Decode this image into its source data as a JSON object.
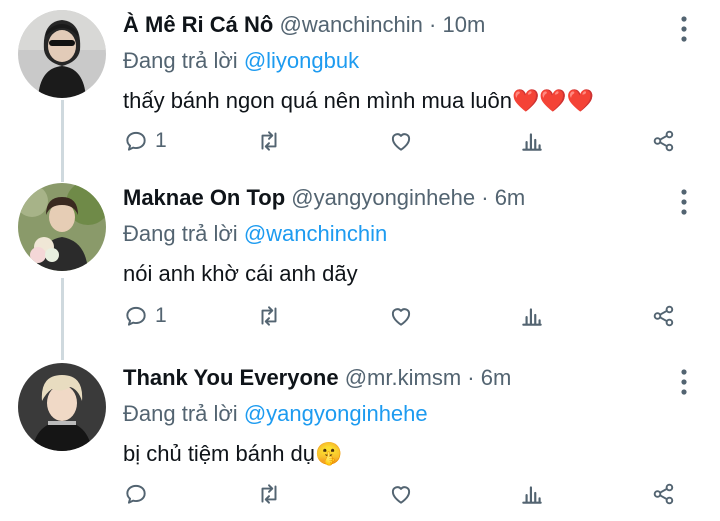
{
  "tweets": [
    {
      "name": "À Mê Ri Cá Nô",
      "handle": "@wanchinchin",
      "separator": "·",
      "time": "10m",
      "replying_prefix": "Đang trả lời",
      "replying_to": "@liyongbuk",
      "text": "thấy bánh ngon quá nên mình mua luôn",
      "emoji": "❤️❤️❤️",
      "reply_count": "1"
    },
    {
      "name": "Maknae On Top",
      "handle": "@yangyonginhehe",
      "separator": "·",
      "time": "6m",
      "replying_prefix": "Đang trả lời",
      "replying_to": "@wanchinchin",
      "text": "nói anh khờ cái anh dãy",
      "emoji": "",
      "reply_count": "1"
    },
    {
      "name": "Thank You Everyone",
      "handle": "@mr.kimsm",
      "separator": "·",
      "time": "6m",
      "replying_prefix": "Đang trả lời",
      "replying_to": "@yangyonginhehe",
      "text": "bị chủ tiệm bánh dụ",
      "emoji": "🤫",
      "reply_count": ""
    }
  ],
  "colors": {
    "accent": "#1d9bf0",
    "secondary_text": "#536471",
    "thread_line": "#cfd9de",
    "heart_emoji": "#e0245e"
  },
  "icons": [
    "reply-icon",
    "retweet-icon",
    "like-icon",
    "views-icon",
    "share-icon",
    "more-options-icon"
  ]
}
